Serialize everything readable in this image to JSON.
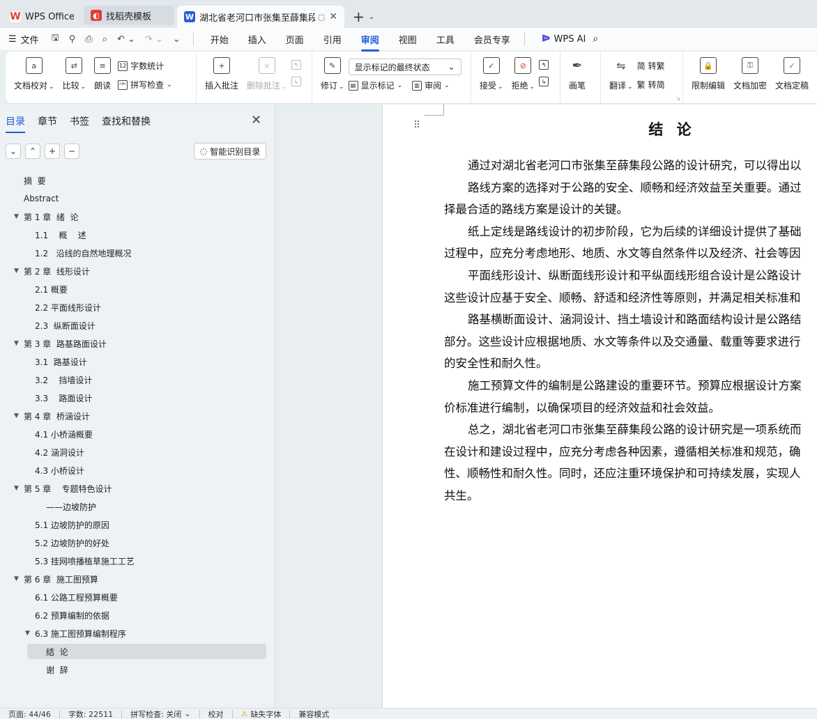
{
  "tabs": [
    {
      "label": "WPS Office",
      "icon": "wps-logo-icon",
      "color": "#e53935"
    },
    {
      "label": "找稻壳模板",
      "icon": "docer-icon",
      "color": "#e53935"
    },
    {
      "label": "湖北省老河口市张集至薛集段公",
      "icon": "word-doc-icon",
      "color": "#2b5cd6"
    }
  ],
  "menubar": {
    "file": "文件",
    "items": [
      "开始",
      "插入",
      "页面",
      "引用",
      "审阅",
      "视图",
      "工具",
      "会员专享"
    ],
    "active": "审阅",
    "wps_ai": "WPS AI"
  },
  "ribbon": {
    "doc_check": "文档校对",
    "compare": "比较",
    "read_aloud": "朗读",
    "word_count": "字数统计",
    "spell_check": "拼写检查",
    "insert_comment": "插入批注",
    "delete_comment": "删除批注",
    "revise": "修订",
    "display_state": "显示标记的最终状态",
    "show_markup": "显示标记",
    "review": "审阅",
    "accept": "接受",
    "reject": "拒绝",
    "pen": "画笔",
    "translate": "翻译",
    "to_traditional": "转繁",
    "to_simplified": "转简",
    "restrict_edit": "限制编辑",
    "encrypt": "文档加密",
    "finalize": "文档定稿"
  },
  "nav": {
    "tabs": [
      "目录",
      "章节",
      "书签",
      "查找和替换"
    ],
    "smart_toc": "智能识别目录",
    "toc": [
      {
        "label": "摘  要",
        "level": 0,
        "arrow": false
      },
      {
        "label": "Abstract",
        "level": 0,
        "arrow": false
      },
      {
        "label": "第 1 章  绪  论",
        "level": 0,
        "arrow": true
      },
      {
        "label": "1.1    概    述",
        "level": 1,
        "arrow": false
      },
      {
        "label": "1.2   沿线的自然地理概况",
        "level": 1,
        "arrow": false
      },
      {
        "label": "第 2 章  线形设计",
        "level": 0,
        "arrow": true
      },
      {
        "label": "2.1 概要",
        "level": 1,
        "arrow": false
      },
      {
        "label": "2.2 平面线形设计",
        "level": 1,
        "arrow": false
      },
      {
        "label": "2.3  纵断面设计",
        "level": 1,
        "arrow": false
      },
      {
        "label": "第 3 章  路基路面设计",
        "level": 0,
        "arrow": true
      },
      {
        "label": "3.1  路基设计",
        "level": 1,
        "arrow": false
      },
      {
        "label": "3.2    挡墙设计",
        "level": 1,
        "arrow": false
      },
      {
        "label": "3.3    路面设计",
        "level": 1,
        "arrow": false
      },
      {
        "label": "第 4 章  桥涵设计",
        "level": 0,
        "arrow": true
      },
      {
        "label": "4.1 小桥涵概要",
        "level": 1,
        "arrow": false
      },
      {
        "label": "4.2 涵洞设计",
        "level": 1,
        "arrow": false
      },
      {
        "label": "4.3 小桥设计",
        "level": 1,
        "arrow": false
      },
      {
        "label": "第 5 章    专题特色设计",
        "level": 0,
        "arrow": true
      },
      {
        "label": "——边坡防护",
        "level": 2,
        "arrow": false
      },
      {
        "label": "5.1 边坡防护的原因",
        "level": 1,
        "arrow": false
      },
      {
        "label": "5.2 边坡防护的好处",
        "level": 1,
        "arrow": false
      },
      {
        "label": "5.3 挂网喷播植草施工工艺",
        "level": 1,
        "arrow": false
      },
      {
        "label": "第 6 章  施工图预算",
        "level": 0,
        "arrow": true
      },
      {
        "label": "6.1 公路工程预算概要",
        "level": 1,
        "arrow": false
      },
      {
        "label": "6.2 预算编制的依据",
        "level": 1,
        "arrow": false
      },
      {
        "label": "6.3 施工图预算编制程序",
        "level": 1,
        "arrow": true
      },
      {
        "label": "结  论",
        "level": 2,
        "arrow": false,
        "selected": true
      },
      {
        "label": "谢  辞",
        "level": 2,
        "arrow": false
      }
    ]
  },
  "document": {
    "heading": "结 论",
    "lines": [
      {
        "text": "通过对湖北省老河口市张集至薛集段公路的设计研究，可以得出以",
        "indent": true
      },
      {
        "text": "路线方案的选择对于公路的安全、顺畅和经济效益至关重要。通过",
        "indent": true
      },
      {
        "text": "择最合适的路线方案是设计的关键。",
        "indent": false
      },
      {
        "text": "纸上定线是路线设计的初步阶段，它为后续的详细设计提供了基础",
        "indent": true
      },
      {
        "text": "过程中，应充分考虑地形、地质、水文等自然条件以及经济、社会等因",
        "indent": false
      },
      {
        "text": "平面线形设计、纵断面线形设计和平纵面线形组合设计是公路设计",
        "indent": true
      },
      {
        "text": "这些设计应基于安全、顺畅、舒适和经济性等原则，并满足相关标准和",
        "indent": false
      },
      {
        "text": "路基横断面设计、涵洞设计、挡土墙设计和路面结构设计是公路结",
        "indent": true
      },
      {
        "text": "部分。这些设计应根据地质、水文等条件以及交通量、载重等要求进行",
        "indent": false
      },
      {
        "text": "的安全性和耐久性。",
        "indent": false
      },
      {
        "text": "施工预算文件的编制是公路建设的重要环节。预算应根据设计方案",
        "indent": true
      },
      {
        "text": "价标准进行编制，以确保项目的经济效益和社会效益。",
        "indent": false
      },
      {
        "text": "总之，湖北省老河口市张集至薛集段公路的设计研究是一项系统而",
        "indent": true
      },
      {
        "text": "在设计和建设过程中，应充分考虑各种因素，遵循相关标准和规范，确",
        "indent": false
      },
      {
        "text": "性、顺畅性和耐久性。同时，还应注重环境保护和可持续发展，实现人",
        "indent": false
      },
      {
        "text": "共生。",
        "indent": false
      }
    ]
  },
  "status": {
    "page": "页面: 44/46",
    "words": "字数: 22511",
    "spell": "拼写检查: 关闭",
    "proof": "校对",
    "missing_font": "缺失字体",
    "compat": "兼容模式"
  },
  "colors": {
    "accent": "#1f5fd6",
    "wps_red": "#e53935"
  }
}
